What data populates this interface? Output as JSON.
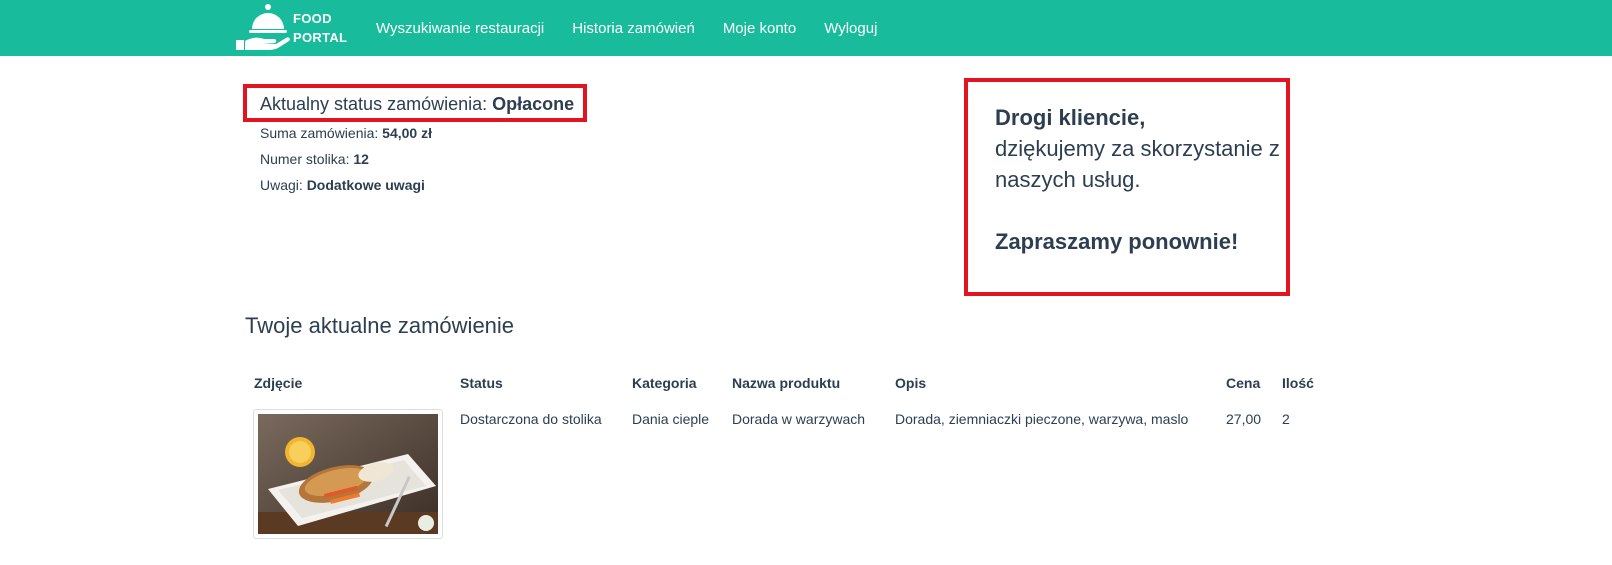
{
  "header": {
    "logo_line1": "FOOD",
    "logo_line2": "PORTAL",
    "nav": [
      {
        "label": "Wyszukiwanie restauracji"
      },
      {
        "label": "Historia zamówień"
      },
      {
        "label": "Moje konto"
      },
      {
        "label": "Wyloguj"
      }
    ],
    "bg_color": "#18bc9c"
  },
  "status": {
    "label": "Aktualny status zamówienia: ",
    "value": "Opłacone",
    "sum_label": "Suma zamówienia: ",
    "sum_value": "54,00 zł",
    "table_label": "Numer stolika: ",
    "table_value": "12",
    "notes_label": "Uwagi: ",
    "notes_value": "Dodatkowe uwagi"
  },
  "thanks": {
    "greeting": "Drogi kliencie,",
    "message": "dziękujemy za skorzystanie z naszych usług.",
    "invite": "Zapraszamy ponownie!"
  },
  "order": {
    "title": "Twoje aktualne zamówienie",
    "columns": [
      "Zdjęcie",
      "Status",
      "Kategoria",
      "Nazwa produktu",
      "Opis",
      "Cena",
      "Ilość"
    ],
    "rows": [
      {
        "image": "fish-dish-photo",
        "status": "Dostarczona do stolika",
        "category": "Dania cieple",
        "name": "Dorada w warzywach",
        "description": "Dorada, ziemniaczki pieczone, warzywa, maslo",
        "price": "27,00",
        "qty": "2"
      }
    ]
  },
  "colors": {
    "accent": "#18bc9c",
    "highlight_border": "#e0151f",
    "text": "#2c3e50"
  }
}
